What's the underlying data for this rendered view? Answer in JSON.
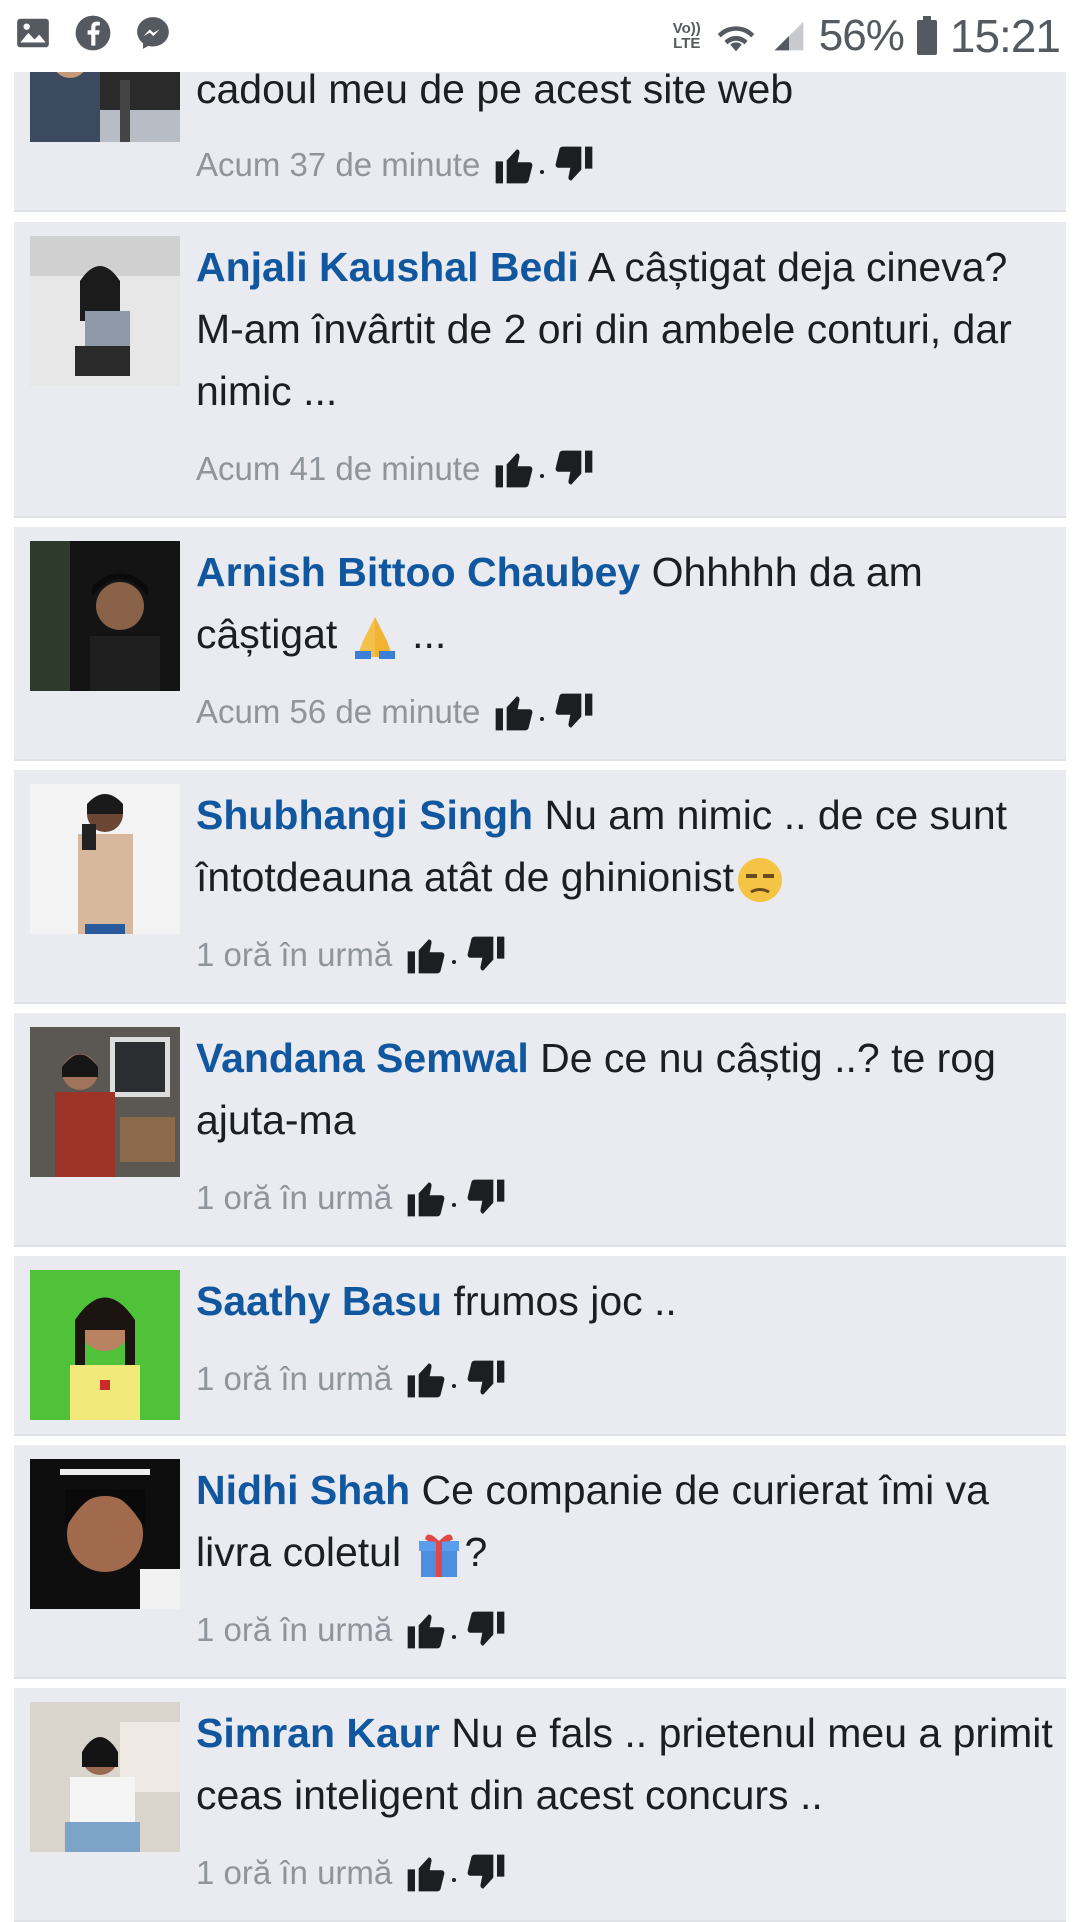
{
  "status_bar": {
    "left_icons": [
      "gallery-icon",
      "facebook-icon",
      "messenger-icon"
    ],
    "volte_line1": "Vo))",
    "volte_line2": "LTE",
    "battery_percent": "56%",
    "time": "15:21"
  },
  "colors": {
    "name": "#10579f",
    "card_bg": "#e9ebf0",
    "meta": "#90949c"
  },
  "comments": [
    {
      "name": "",
      "text": "cadoul meu de pe acest site web",
      "time": "Acum 37 de minute"
    },
    {
      "name": "Anjali Kaushal Bedi",
      "text": "A câștigat deja cineva? M-am învârtit de 2 ori din ambele conturi, dar nimic ...",
      "time": "Acum 41 de minute"
    },
    {
      "name": "Arnish Bittoo Chaubey",
      "text": "Ohhhhh da am câștigat",
      "text_after_emoji": " ...",
      "emoji": "folded-hands-emoji",
      "time": "Acum 56 de minute"
    },
    {
      "name": "Shubhangi Singh",
      "text": "Nu am nimic .. de ce sunt întotdeauna atât de ghinionist",
      "emoji": "unamused-face-emoji",
      "time": "1 oră în urmă"
    },
    {
      "name": "Vandana Semwal",
      "text": "De ce nu câștig ..? te rog ajuta-ma",
      "time": "1 oră în urmă"
    },
    {
      "name": "Saathy Basu",
      "text": "frumos joc ..",
      "time": "1 oră în urmă"
    },
    {
      "name": "Nidhi Shah",
      "text": "Ce companie de curierat îmi va livra coletul",
      "text_after_emoji": "?",
      "emoji": "gift-emoji",
      "time": "1 oră în urmă"
    },
    {
      "name": "Simran Kaur",
      "text": "Nu e fals .. prietenul meu a primit ceas inteligent din acest concurs ..",
      "time": "1 oră în urmă"
    }
  ]
}
